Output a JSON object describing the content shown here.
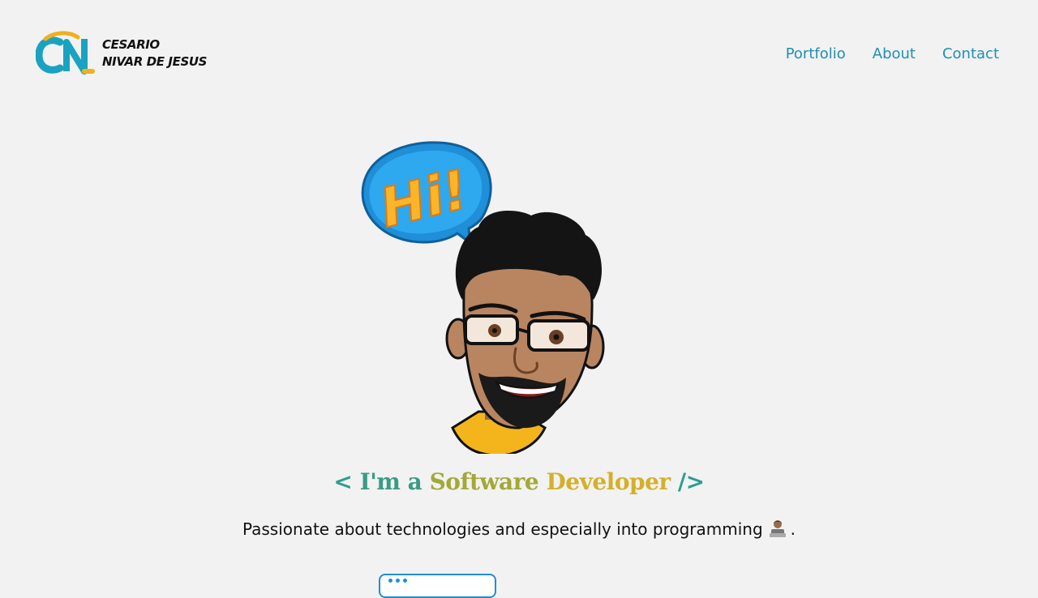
{
  "header": {
    "logo": {
      "line1": "CESARIO",
      "line2": "NIVAR DE JESUS",
      "mark_text": "CN"
    },
    "nav": [
      {
        "label": "Portfolio"
      },
      {
        "label": "About"
      },
      {
        "label": "Contact"
      }
    ]
  },
  "hero": {
    "speech_bubble": "Hi!",
    "tagline": {
      "open": "<",
      "im": "I'm a",
      "software": "Software",
      "developer": "Developer",
      "close": "/>"
    },
    "subtitle": "Passionate about technologies and especially into programming",
    "subtitle_end": "."
  },
  "colors": {
    "background": "#f2f2f2",
    "nav_link": "#1f8fb6",
    "accent_blue": "#1e8fd8",
    "logo_teal": "#1aa3c0",
    "logo_gold": "#f2b01e"
  },
  "icons": {
    "avatar": "memoji-avatar",
    "subtitle_emoji": "technologist-emoji"
  }
}
